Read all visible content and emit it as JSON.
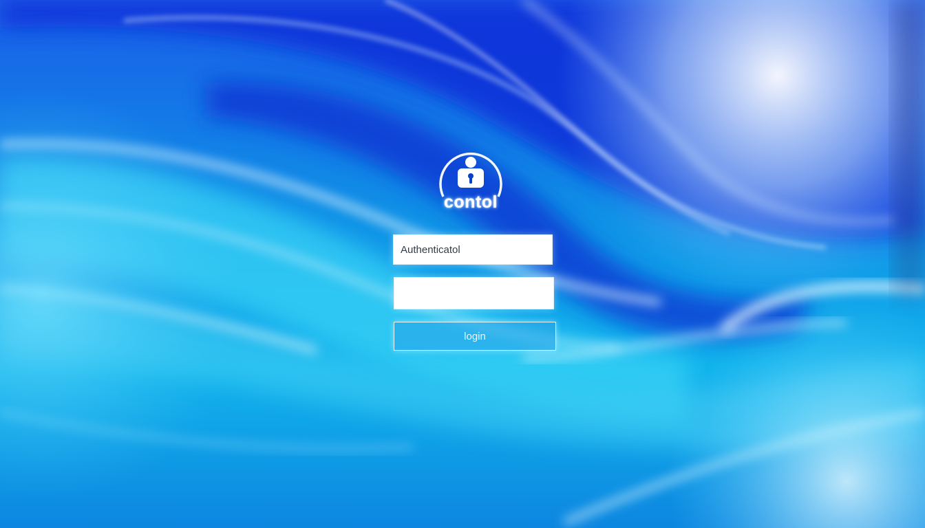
{
  "logo": {
    "icon": "user-lock-icon",
    "text": "contol"
  },
  "login_form": {
    "username_value": "Authenticatol",
    "password_value": "",
    "login_label": "login"
  },
  "colors": {
    "background_primary": "#0a6ee0",
    "background_deep": "#0a32d8",
    "background_light": "#2ec4f2",
    "highlight": "#e8f8ff",
    "button_border": "#ebfaff"
  }
}
